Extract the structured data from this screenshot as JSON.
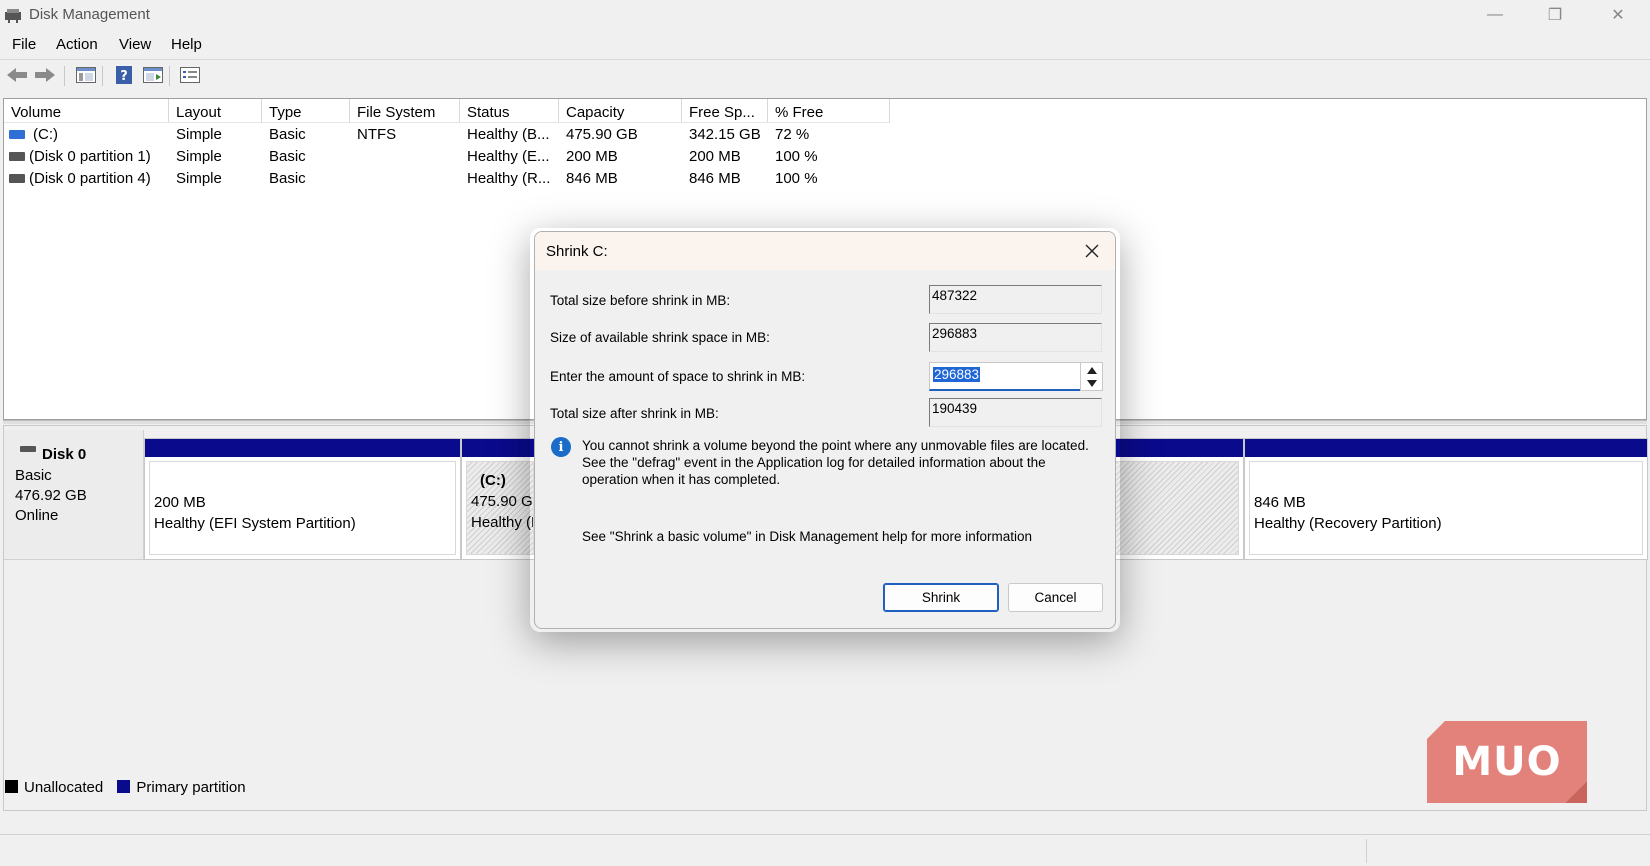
{
  "window": {
    "title": "Disk Management",
    "minimize_glyph": "—",
    "restore_glyph": "❐",
    "close_glyph": "✕"
  },
  "menu": [
    "File",
    "Action",
    "View",
    "Help"
  ],
  "toolbar": {
    "icons": [
      "back-arrow-icon",
      "forward-arrow-icon",
      "console-tree-icon",
      "help-icon",
      "properties-icon",
      "settings-list-icon"
    ]
  },
  "volume_table": {
    "headers": [
      "Volume",
      "Layout",
      "Type",
      "File System",
      "Status",
      "Capacity",
      "Free Sp...",
      "% Free"
    ],
    "rows": [
      {
        "volume": "(C:)",
        "layout": "Simple",
        "type": "Basic",
        "fs": "NTFS",
        "status": "Healthy (B...",
        "capacity": "475.90 GB",
        "free": "342.15 GB",
        "pct": "72 %",
        "icon_color": "#2f6fd6"
      },
      {
        "volume": "(Disk 0 partition 1)",
        "layout": "Simple",
        "type": "Basic",
        "fs": "",
        "status": "Healthy (E...",
        "capacity": "200 MB",
        "free": "200 MB",
        "pct": "100 %",
        "icon_color": "#555555"
      },
      {
        "volume": "(Disk 0 partition 4)",
        "layout": "Simple",
        "type": "Basic",
        "fs": "",
        "status": "Healthy (R...",
        "capacity": "846 MB",
        "free": "846 MB",
        "pct": "100 %",
        "icon_color": "#555555"
      }
    ]
  },
  "disk": {
    "name": "Disk 0",
    "type": "Basic",
    "size": "476.92 GB",
    "state": "Online",
    "partitions": [
      {
        "label": "",
        "size": "200 MB",
        "status": "Healthy (EFI System Partition)"
      },
      {
        "label": "(C:)",
        "size": "475.90 GB",
        "status": "Healthy (B"
      },
      {
        "label": "",
        "size": "",
        "status": ""
      },
      {
        "label": "",
        "size": "846 MB",
        "status": "Healthy (Recovery Partition)"
      }
    ]
  },
  "legend": {
    "unallocated": "Unallocated",
    "primary": "Primary partition",
    "unallocated_color": "#000000",
    "primary_color": "#0a0a8c"
  },
  "dialog": {
    "title": "Shrink C:",
    "total_before_label": "Total size before shrink in MB:",
    "total_before_value": "487322",
    "available_label": "Size of available shrink space in MB:",
    "available_value": "296883",
    "amount_label": "Enter the amount of space to shrink in MB:",
    "amount_value": "296883",
    "total_after_label": "Total size after shrink in MB:",
    "total_after_value": "190439",
    "info_text": "You cannot shrink a volume beyond the point where any unmovable files are located. See the \"defrag\" event in the Application log for detailed information about the operation when it has completed.",
    "help_text": "See \"Shrink a basic volume\" in Disk Management help for more information",
    "shrink_button": "Shrink",
    "cancel_button": "Cancel"
  },
  "watermark": {
    "text": "MUO",
    "color": "#e07b73"
  }
}
